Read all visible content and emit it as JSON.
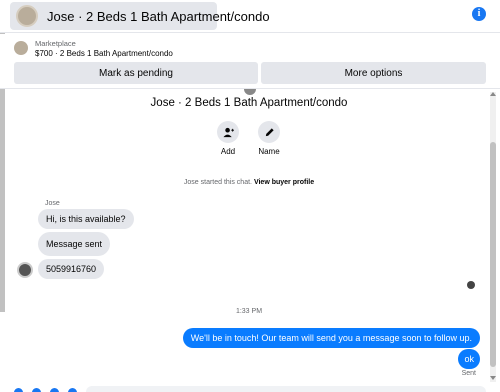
{
  "header": {
    "title": "Jose · 2 Beds 1 Bath Apartment/condo",
    "info_icon": "i"
  },
  "marketplace": {
    "label": "Marketplace",
    "listing": "$700 · 2 Beds 1 Bath Apartment/condo",
    "mark_pending_label": "Mark as pending",
    "more_options_label": "More options"
  },
  "conversation": {
    "title": "Jose · 2 Beds 1 Bath Apartment/condo",
    "actions": [
      {
        "label": "Add",
        "icon": "add-person-icon"
      },
      {
        "label": "Name",
        "icon": "pencil-icon"
      }
    ],
    "started_text": "Jose started this chat.",
    "started_link": "View buyer profile",
    "sender_name": "Jose",
    "incoming": [
      "Hi, is this available?",
      "Message sent",
      "5059916760"
    ],
    "timestamp": "1:33 PM",
    "outgoing": [
      "We'll be in touch! Our team will send you a message soon to follow up.",
      "ok"
    ],
    "status": "Sent"
  },
  "colors": {
    "accent": "#0a7cff",
    "bubble_in": "#e4e6eb",
    "muted_text": "#65676b"
  }
}
